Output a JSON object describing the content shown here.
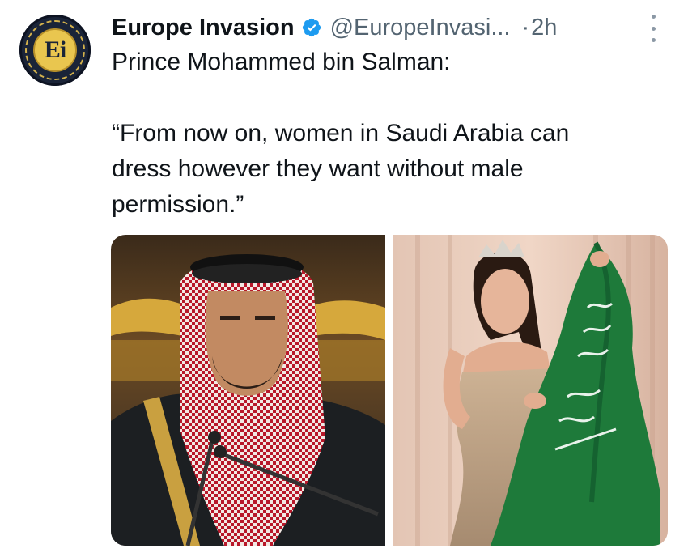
{
  "account": {
    "display_name": "Europe Invasion",
    "handle": "@EuropeInvasi...",
    "time_separator": "·",
    "time": "2h",
    "avatar_text": "Ei",
    "verified_icon": "verified-badge-icon",
    "more_icon": "more-vertical-icon"
  },
  "tweet": {
    "lines": [
      "Prince Mohammed bin Salman:",
      "“From now on, women in Saudi Arabia can",
      "dress however they want without male",
      "permission.”"
    ]
  },
  "media": {
    "images": [
      "photo-left",
      "photo-right"
    ]
  },
  "colors": {
    "text": "#0f1419",
    "secondary": "#536471",
    "verified": "#1d9bf0",
    "avatar_bg": "#1a2438",
    "avatar_gold": "#e9c64f"
  }
}
